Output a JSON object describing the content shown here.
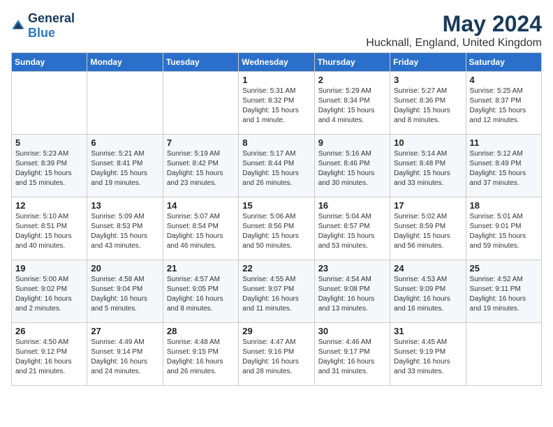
{
  "logo": {
    "general": "General",
    "blue": "Blue"
  },
  "title": "May 2024",
  "subtitle": "Hucknall, England, United Kingdom",
  "days_header": [
    "Sunday",
    "Monday",
    "Tuesday",
    "Wednesday",
    "Thursday",
    "Friday",
    "Saturday"
  ],
  "weeks": [
    [
      {
        "day": "",
        "info": ""
      },
      {
        "day": "",
        "info": ""
      },
      {
        "day": "",
        "info": ""
      },
      {
        "day": "1",
        "info": "Sunrise: 5:31 AM\nSunset: 8:32 PM\nDaylight: 15 hours\nand 1 minute."
      },
      {
        "day": "2",
        "info": "Sunrise: 5:29 AM\nSunset: 8:34 PM\nDaylight: 15 hours\nand 4 minutes."
      },
      {
        "day": "3",
        "info": "Sunrise: 5:27 AM\nSunset: 8:36 PM\nDaylight: 15 hours\nand 8 minutes."
      },
      {
        "day": "4",
        "info": "Sunrise: 5:25 AM\nSunset: 8:37 PM\nDaylight: 15 hours\nand 12 minutes."
      }
    ],
    [
      {
        "day": "5",
        "info": "Sunrise: 5:23 AM\nSunset: 8:39 PM\nDaylight: 15 hours\nand 15 minutes."
      },
      {
        "day": "6",
        "info": "Sunrise: 5:21 AM\nSunset: 8:41 PM\nDaylight: 15 hours\nand 19 minutes."
      },
      {
        "day": "7",
        "info": "Sunrise: 5:19 AM\nSunset: 8:42 PM\nDaylight: 15 hours\nand 23 minutes."
      },
      {
        "day": "8",
        "info": "Sunrise: 5:17 AM\nSunset: 8:44 PM\nDaylight: 15 hours\nand 26 minutes."
      },
      {
        "day": "9",
        "info": "Sunrise: 5:16 AM\nSunset: 8:46 PM\nDaylight: 15 hours\nand 30 minutes."
      },
      {
        "day": "10",
        "info": "Sunrise: 5:14 AM\nSunset: 8:48 PM\nDaylight: 15 hours\nand 33 minutes."
      },
      {
        "day": "11",
        "info": "Sunrise: 5:12 AM\nSunset: 8:49 PM\nDaylight: 15 hours\nand 37 minutes."
      }
    ],
    [
      {
        "day": "12",
        "info": "Sunrise: 5:10 AM\nSunset: 8:51 PM\nDaylight: 15 hours\nand 40 minutes."
      },
      {
        "day": "13",
        "info": "Sunrise: 5:09 AM\nSunset: 8:53 PM\nDaylight: 15 hours\nand 43 minutes."
      },
      {
        "day": "14",
        "info": "Sunrise: 5:07 AM\nSunset: 8:54 PM\nDaylight: 15 hours\nand 46 minutes."
      },
      {
        "day": "15",
        "info": "Sunrise: 5:06 AM\nSunset: 8:56 PM\nDaylight: 15 hours\nand 50 minutes."
      },
      {
        "day": "16",
        "info": "Sunrise: 5:04 AM\nSunset: 8:57 PM\nDaylight: 15 hours\nand 53 minutes."
      },
      {
        "day": "17",
        "info": "Sunrise: 5:02 AM\nSunset: 8:59 PM\nDaylight: 15 hours\nand 56 minutes."
      },
      {
        "day": "18",
        "info": "Sunrise: 5:01 AM\nSunset: 9:01 PM\nDaylight: 15 hours\nand 59 minutes."
      }
    ],
    [
      {
        "day": "19",
        "info": "Sunrise: 5:00 AM\nSunset: 9:02 PM\nDaylight: 16 hours\nand 2 minutes."
      },
      {
        "day": "20",
        "info": "Sunrise: 4:58 AM\nSunset: 9:04 PM\nDaylight: 16 hours\nand 5 minutes."
      },
      {
        "day": "21",
        "info": "Sunrise: 4:57 AM\nSunset: 9:05 PM\nDaylight: 16 hours\nand 8 minutes."
      },
      {
        "day": "22",
        "info": "Sunrise: 4:55 AM\nSunset: 9:07 PM\nDaylight: 16 hours\nand 11 minutes."
      },
      {
        "day": "23",
        "info": "Sunrise: 4:54 AM\nSunset: 9:08 PM\nDaylight: 16 hours\nand 13 minutes."
      },
      {
        "day": "24",
        "info": "Sunrise: 4:53 AM\nSunset: 9:09 PM\nDaylight: 16 hours\nand 16 minutes."
      },
      {
        "day": "25",
        "info": "Sunrise: 4:52 AM\nSunset: 9:11 PM\nDaylight: 16 hours\nand 19 minutes."
      }
    ],
    [
      {
        "day": "26",
        "info": "Sunrise: 4:50 AM\nSunset: 9:12 PM\nDaylight: 16 hours\nand 21 minutes."
      },
      {
        "day": "27",
        "info": "Sunrise: 4:49 AM\nSunset: 9:14 PM\nDaylight: 16 hours\nand 24 minutes."
      },
      {
        "day": "28",
        "info": "Sunrise: 4:48 AM\nSunset: 9:15 PM\nDaylight: 16 hours\nand 26 minutes."
      },
      {
        "day": "29",
        "info": "Sunrise: 4:47 AM\nSunset: 9:16 PM\nDaylight: 16 hours\nand 28 minutes."
      },
      {
        "day": "30",
        "info": "Sunrise: 4:46 AM\nSunset: 9:17 PM\nDaylight: 16 hours\nand 31 minutes."
      },
      {
        "day": "31",
        "info": "Sunrise: 4:45 AM\nSunset: 9:19 PM\nDaylight: 16 hours\nand 33 minutes."
      },
      {
        "day": "",
        "info": ""
      }
    ]
  ]
}
